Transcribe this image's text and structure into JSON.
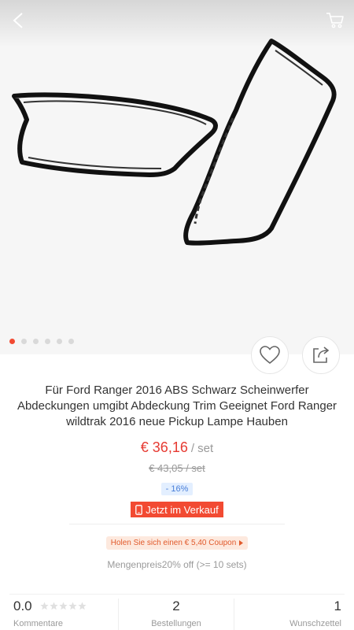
{
  "product": {
    "title": "Für Ford Ranger 2016 ABS Schwarz Scheinwerfer Abdeckungen umgibt Abdeckung Trim Geeignet Ford Ranger wildtrak 2016 neue Pickup Lampe Hauben",
    "price": "€ 36,16",
    "price_unit": "/ set",
    "old_price": "€ 43,05  / set",
    "discount": "- 16%",
    "sale_label": "Jetzt im Verkauf",
    "coupon_label": "Holen Sie sich einen € 5,40 Coupon",
    "bulk_price": "Mengenpreis20% off (>= 10 sets)"
  },
  "gallery": {
    "image_count": 6,
    "active_index": 0
  },
  "stats": {
    "rating": "0.0",
    "rating_label": "Kommentare",
    "orders": "2",
    "orders_label": "Bestellungen",
    "wishlist": "1",
    "wishlist_label": "Wunschzettel"
  },
  "icons": {
    "back": "chevron-left-icon",
    "cart": "cart-icon",
    "favorite": "heart-icon",
    "share": "share-icon",
    "sale": "phone-icon",
    "coupon": "triangle-right-icon"
  },
  "colors": {
    "accent": "#f24a32",
    "price": "#e63a32",
    "discount_text": "#4a7fd9",
    "discount_bg": "#e3efff",
    "coupon_bg": "#fde9de",
    "coupon_text": "#e15a2c"
  }
}
